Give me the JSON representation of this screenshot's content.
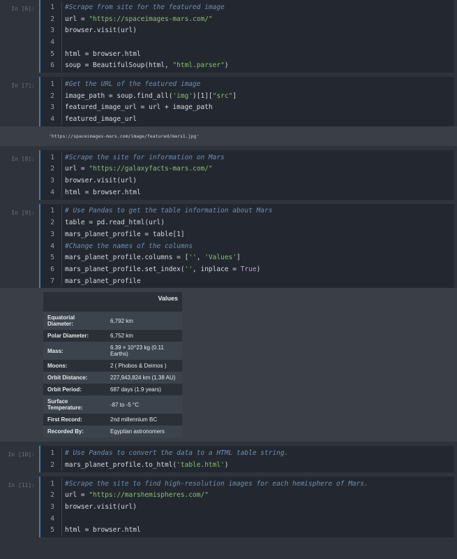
{
  "cells": [
    {
      "prompt": "In [6]:",
      "lines": [
        {
          "n": "1",
          "parts": [
            [
              "cm",
              "#Scrape from site for the featured image"
            ]
          ]
        },
        {
          "n": "2",
          "parts": [
            [
              "",
              "url = "
            ],
            [
              "st",
              "\"https://spaceimages-mars.com/\""
            ]
          ]
        },
        {
          "n": "3",
          "parts": [
            [
              "",
              "browser.visit(url)"
            ]
          ]
        },
        {
          "n": "4",
          "parts": []
        },
        {
          "n": "5",
          "parts": [
            [
              "",
              "html = browser.html"
            ]
          ]
        },
        {
          "n": "6",
          "parts": [
            [
              "",
              "soup = BeautifulSoup(html, "
            ],
            [
              "st",
              "\"html.parser\""
            ],
            [
              "",
              ")"
            ]
          ]
        }
      ]
    },
    {
      "prompt": "In [7]:",
      "lines": [
        {
          "n": "1",
          "parts": [
            [
              "cm",
              "#Get the URL of the featured image"
            ]
          ]
        },
        {
          "n": "2",
          "parts": [
            [
              "",
              "image_path = soup.find_all("
            ],
            [
              "st",
              "'img'"
            ],
            [
              "",
              ")[1]["
            ],
            [
              "st",
              "\"src\""
            ],
            [
              "",
              "]"
            ]
          ]
        },
        {
          "n": "3",
          "parts": [
            [
              "",
              "featured_image_url = url + image_path"
            ]
          ]
        },
        {
          "n": "4",
          "parts": [
            [
              "",
              "featured_image_url"
            ]
          ]
        }
      ],
      "output_text": "'https://spaceimages-mars.com/image/featured/mars1.jpg'"
    },
    {
      "prompt": "In [8]:",
      "lines": [
        {
          "n": "1",
          "parts": [
            [
              "cm",
              "#Scrape the site for information on Mars"
            ]
          ]
        },
        {
          "n": "2",
          "parts": [
            [
              "",
              "url = "
            ],
            [
              "st",
              "\"https://galaxyfacts-mars.com/\""
            ]
          ]
        },
        {
          "n": "3",
          "parts": [
            [
              "",
              "browser.visit(url)"
            ]
          ]
        },
        {
          "n": "4",
          "parts": [
            [
              "",
              "html = browser.html"
            ]
          ]
        }
      ]
    },
    {
      "prompt": "In [9]:",
      "lines": [
        {
          "n": "1",
          "parts": [
            [
              "cm",
              "# Use Pandas to get the table information about Mars"
            ]
          ]
        },
        {
          "n": "2",
          "parts": [
            [
              "",
              "table = pd.read_html(url)"
            ]
          ]
        },
        {
          "n": "3",
          "parts": [
            [
              "",
              "mars_planet_profile = table[1]"
            ]
          ]
        },
        {
          "n": "4",
          "parts": [
            [
              "cm",
              "#Change the names of the columns"
            ]
          ]
        },
        {
          "n": "5",
          "parts": [
            [
              "",
              "mars_planet_profile.columns = ["
            ],
            [
              "st",
              "''"
            ],
            [
              "",
              ", "
            ],
            [
              "st",
              "'Values'"
            ],
            [
              "",
              "]"
            ]
          ]
        },
        {
          "n": "6",
          "parts": [
            [
              "",
              "mars_planet_profile.set_index("
            ],
            [
              "st",
              "''"
            ],
            [
              "",
              ", inplace = "
            ],
            [
              "kw",
              "True"
            ],
            [
              "",
              ")"
            ]
          ]
        },
        {
          "n": "7",
          "parts": [
            [
              "",
              "mars_planet_profile"
            ]
          ]
        }
      ],
      "table": {
        "header": "Values",
        "rows": [
          [
            "Equatorial Diameter:",
            "6,792 km"
          ],
          [
            "Polar Diameter:",
            "6,752 km"
          ],
          [
            "Mass:",
            "6.39 × 10^23 kg (0.11 Earths)"
          ],
          [
            "Moons:",
            "2 ( Phobos & Deimos )"
          ],
          [
            "Orbit Distance:",
            "227,943,824 km (1.38 AU)"
          ],
          [
            "Orbit Period:",
            "687 days (1.9 years)"
          ],
          [
            "Surface Temperature:",
            "-87 to -5 °C"
          ],
          [
            "First Record:",
            "2nd millennium BC"
          ],
          [
            "Recorded By:",
            "Egyptian astronomers"
          ]
        ]
      }
    },
    {
      "prompt": "In [10]:",
      "lines": [
        {
          "n": "1",
          "parts": [
            [
              "cm",
              "# Use Pandas to convert the data to a HTML table string."
            ]
          ]
        },
        {
          "n": "2",
          "parts": [
            [
              "",
              "mars_planet_profile.to_html("
            ],
            [
              "st",
              "'table.html'"
            ],
            [
              "",
              ")"
            ]
          ]
        }
      ]
    },
    {
      "prompt": "In [11]:",
      "lines": [
        {
          "n": "1",
          "parts": [
            [
              "cm",
              "#Scrape the site to find high-resolution images for each hemisphere of Mars."
            ]
          ]
        },
        {
          "n": "2",
          "parts": [
            [
              "",
              "url = "
            ],
            [
              "st",
              "\"https://marshemispheres.com/\""
            ]
          ]
        },
        {
          "n": "3",
          "parts": [
            [
              "",
              "browser.visit(url)"
            ]
          ]
        },
        {
          "n": "4",
          "parts": []
        },
        {
          "n": "5",
          "parts": [
            [
              "",
              "html = browser.html"
            ]
          ]
        }
      ]
    }
  ]
}
